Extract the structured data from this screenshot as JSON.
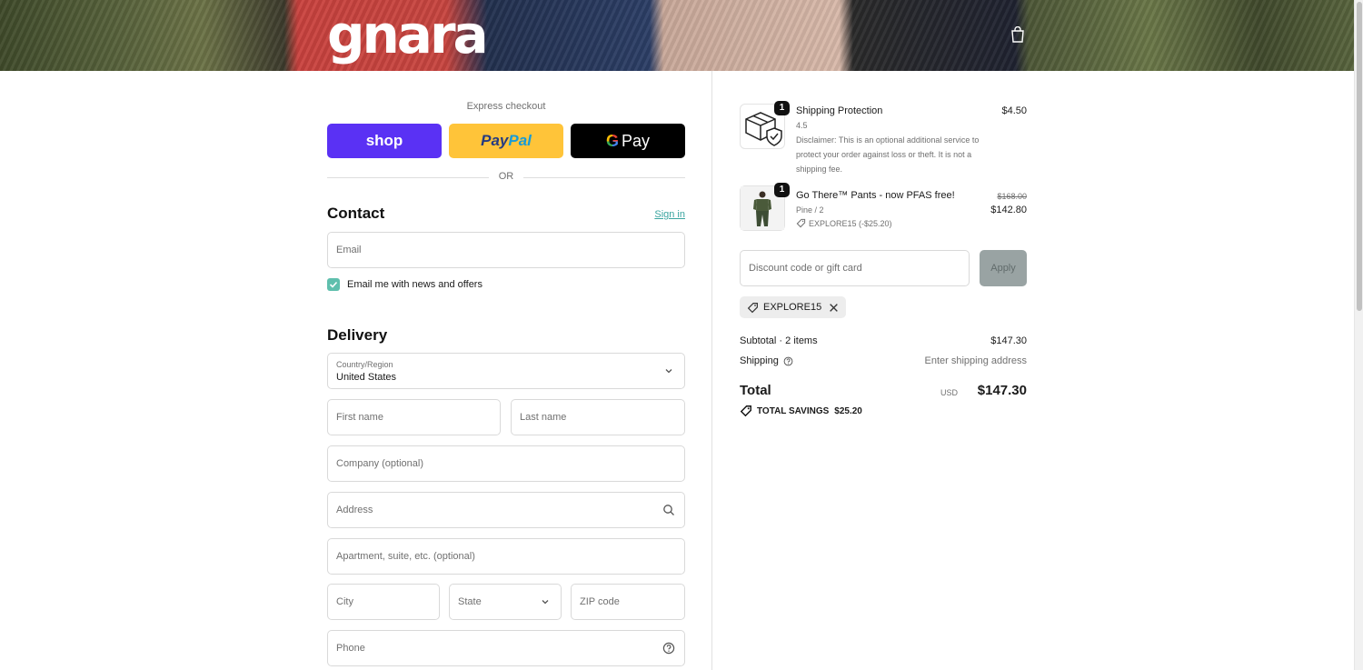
{
  "header": {
    "logo_text": "gnara",
    "cart_icon": "bag-icon"
  },
  "express": {
    "label": "Express checkout",
    "shop_label": "shop",
    "paypal_part1": "Pay",
    "paypal_part2": "Pal",
    "gpay_g": "G",
    "gpay_label": "Pay",
    "or_label": "OR",
    "colors": {
      "shop": "#5a31f4",
      "paypal": "#ffc439",
      "gpay": "#000000"
    }
  },
  "contact": {
    "title": "Contact",
    "sign_in": "Sign in",
    "email_placeholder": "Email",
    "newsletter_label": "Email me with news and offers",
    "newsletter_checked": true
  },
  "delivery": {
    "title": "Delivery",
    "country_label": "Country/Region",
    "country_value": "United States",
    "first_name": "First name",
    "last_name": "Last name",
    "company": "Company (optional)",
    "address": "Address",
    "apartment": "Apartment, suite, etc. (optional)",
    "city": "City",
    "state": "State",
    "zip": "ZIP code",
    "phone": "Phone"
  },
  "order": {
    "items": [
      {
        "name": "Shipping Protection",
        "variant": "4.5",
        "description": "Disclaimer: This is an optional additional service to protect your order against loss or theft. It is not a shipping fee.",
        "quantity": "1",
        "price": "$4.50",
        "icon": "package-shield-icon"
      },
      {
        "name": "Go There™ Pants - now PFAS free!",
        "variant": "Pine / 2",
        "discount": "EXPLORE15 (-$25.20)",
        "quantity": "1",
        "original_price": "$168.00",
        "price": "$142.80"
      }
    ],
    "discount_placeholder": "Discount code or gift card",
    "apply_label": "Apply",
    "applied_code": "EXPLORE15",
    "subtotal_label": "Subtotal · 2 items",
    "subtotal_value": "$147.30",
    "shipping_label": "Shipping",
    "shipping_value": "Enter shipping address",
    "total_label": "Total",
    "total_currency": "USD",
    "total_value": "$147.30",
    "savings_label": "TOTAL SAVINGS",
    "savings_value": "$25.20"
  }
}
